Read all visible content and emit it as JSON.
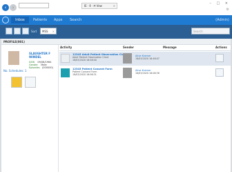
{
  "browser": {
    "address": "",
    "tab_title": "IE · Ⅱ · 🗎 Vew",
    "window_controls": "– □ ×"
  },
  "nav": {
    "items": [
      "Inbox",
      "Patients",
      "Apps",
      "Search"
    ],
    "user": "(Admin)"
  },
  "toolbar": {
    "sort_label": "Sort",
    "filter_value": "MSS",
    "filter_close": "×",
    "search_placeholder": "Search"
  },
  "section": {
    "title": "PROFILE(001)"
  },
  "patient": {
    "name": "SLAUGHTER F WINDEL",
    "rows": [
      {
        "label": "DOB",
        "value": "09/08/1964"
      },
      {
        "label": "Gender",
        "value": "Male"
      },
      {
        "label": "Episodes",
        "value": "(000000)"
      }
    ],
    "schedule_link": "No. Schedules: 1"
  },
  "grid": {
    "headers": [
      "Activity",
      "Sender",
      "Message",
      "Actions"
    ],
    "rows": [
      {
        "title": "12345 Adult Patient Observation Chart",
        "subtitle": "Adult Patient Observation Chart",
        "date": "18/03/2020 16:46:00",
        "sender": "Alive Kramer",
        "sender_date": "18/03/2020 16:46:07"
      },
      {
        "title": "12345 Patient Consent Form",
        "subtitle": "Patient Consent Form",
        "date": "18/03/2020 16:06:31",
        "sender": "Alive Kramer",
        "sender_date": "18/03/2020 16:06:38"
      }
    ]
  },
  "colors": {
    "accent": "#1f7bd2",
    "toolbar": "#2b5f93",
    "selected_row": "#dfe6ef",
    "link": "#1e73c8"
  }
}
